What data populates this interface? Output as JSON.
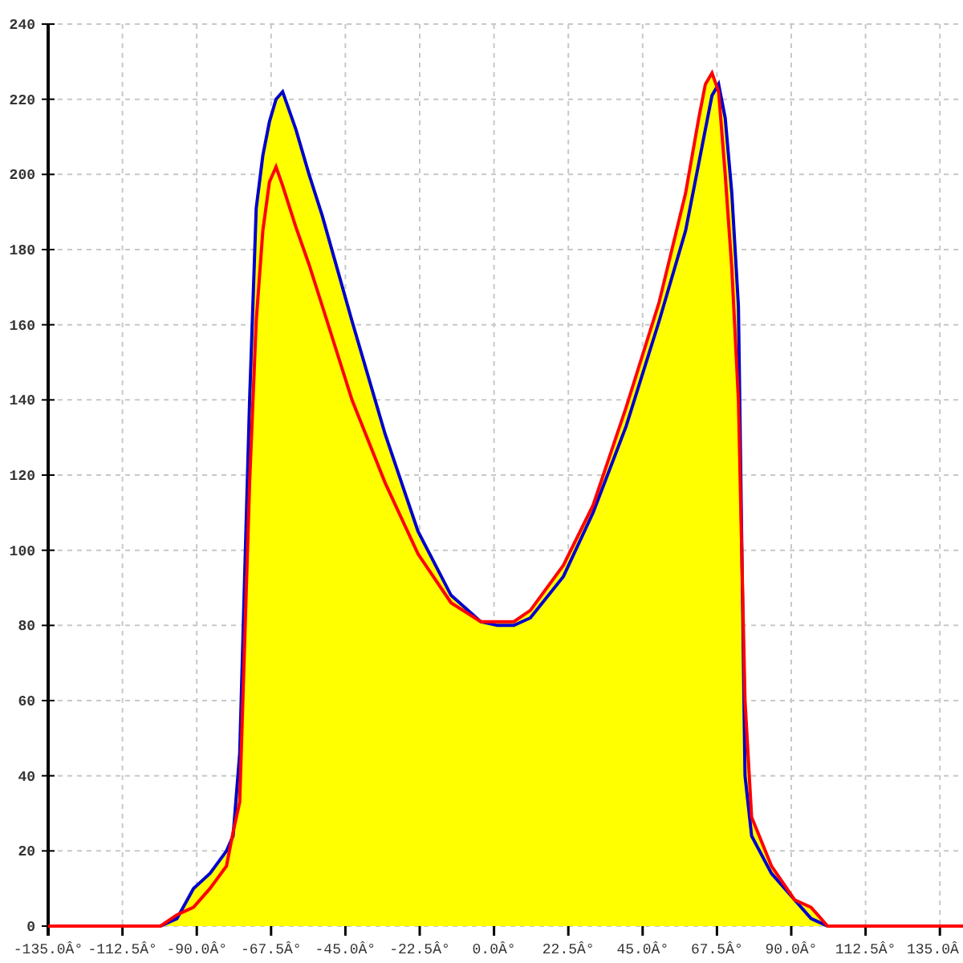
{
  "chart_data": {
    "type": "line",
    "grid": true,
    "x": [
      -135,
      -101,
      -96,
      -91,
      -86,
      -81,
      -79,
      -77,
      -74,
      -72,
      -70,
      -68,
      -66,
      -64,
      -60,
      -56,
      -52,
      -43,
      -33,
      -23,
      -13,
      -4,
      1,
      6,
      11,
      21,
      30,
      40,
      50,
      58,
      62,
      64,
      66,
      68,
      70,
      72,
      74,
      76,
      78,
      84,
      91,
      96,
      101,
      142
    ],
    "series": [
      {
        "color": "#0000cc",
        "values": [
          0,
          0,
          2,
          10,
          14,
          20,
          24,
          46,
          140,
          191,
          205,
          214,
          220,
          222,
          212,
          200,
          189,
          161,
          131,
          105,
          88,
          81,
          80,
          80,
          82,
          93,
          110,
          133,
          161,
          185,
          203,
          212,
          221,
          224,
          215,
          195,
          165,
          40,
          24,
          14,
          7,
          2,
          0,
          0
        ]
      },
      {
        "color": "#ff0000",
        "values": [
          0,
          0,
          3,
          5,
          10,
          16,
          25,
          33,
          118,
          161,
          185,
          198,
          202,
          197,
          186,
          176,
          165,
          140,
          118,
          99,
          86,
          81,
          81,
          81,
          84,
          96,
          112,
          138,
          166,
          195,
          215,
          224,
          227,
          222,
          200,
          175,
          140,
          60,
          29,
          16,
          7,
          5,
          0,
          0
        ]
      }
    ],
    "xlim": [
      -135,
      142
    ],
    "ylim": [
      0,
      240
    ],
    "xticks": [
      {
        "value": -135,
        "label": "-135.0Â°"
      },
      {
        "value": -112.5,
        "label": "-112.5Â°"
      },
      {
        "value": -90,
        "label": "-90.0Â°"
      },
      {
        "value": -67.5,
        "label": "-67.5Â°"
      },
      {
        "value": -45,
        "label": "-45.0Â°"
      },
      {
        "value": -22.5,
        "label": "-22.5Â°"
      },
      {
        "value": 0,
        "label": "0.0Â°"
      },
      {
        "value": 22.5,
        "label": "22.5Â°"
      },
      {
        "value": 45,
        "label": "45.0Â°"
      },
      {
        "value": 67.5,
        "label": "67.5Â°"
      },
      {
        "value": 90,
        "label": "90.0Â°"
      },
      {
        "value": 112.5,
        "label": "112.5Â°"
      },
      {
        "value": 135,
        "label": "135.0Â"
      }
    ],
    "yticks": [
      0,
      20,
      40,
      60,
      80,
      100,
      120,
      140,
      160,
      180,
      200,
      220,
      240
    ]
  }
}
